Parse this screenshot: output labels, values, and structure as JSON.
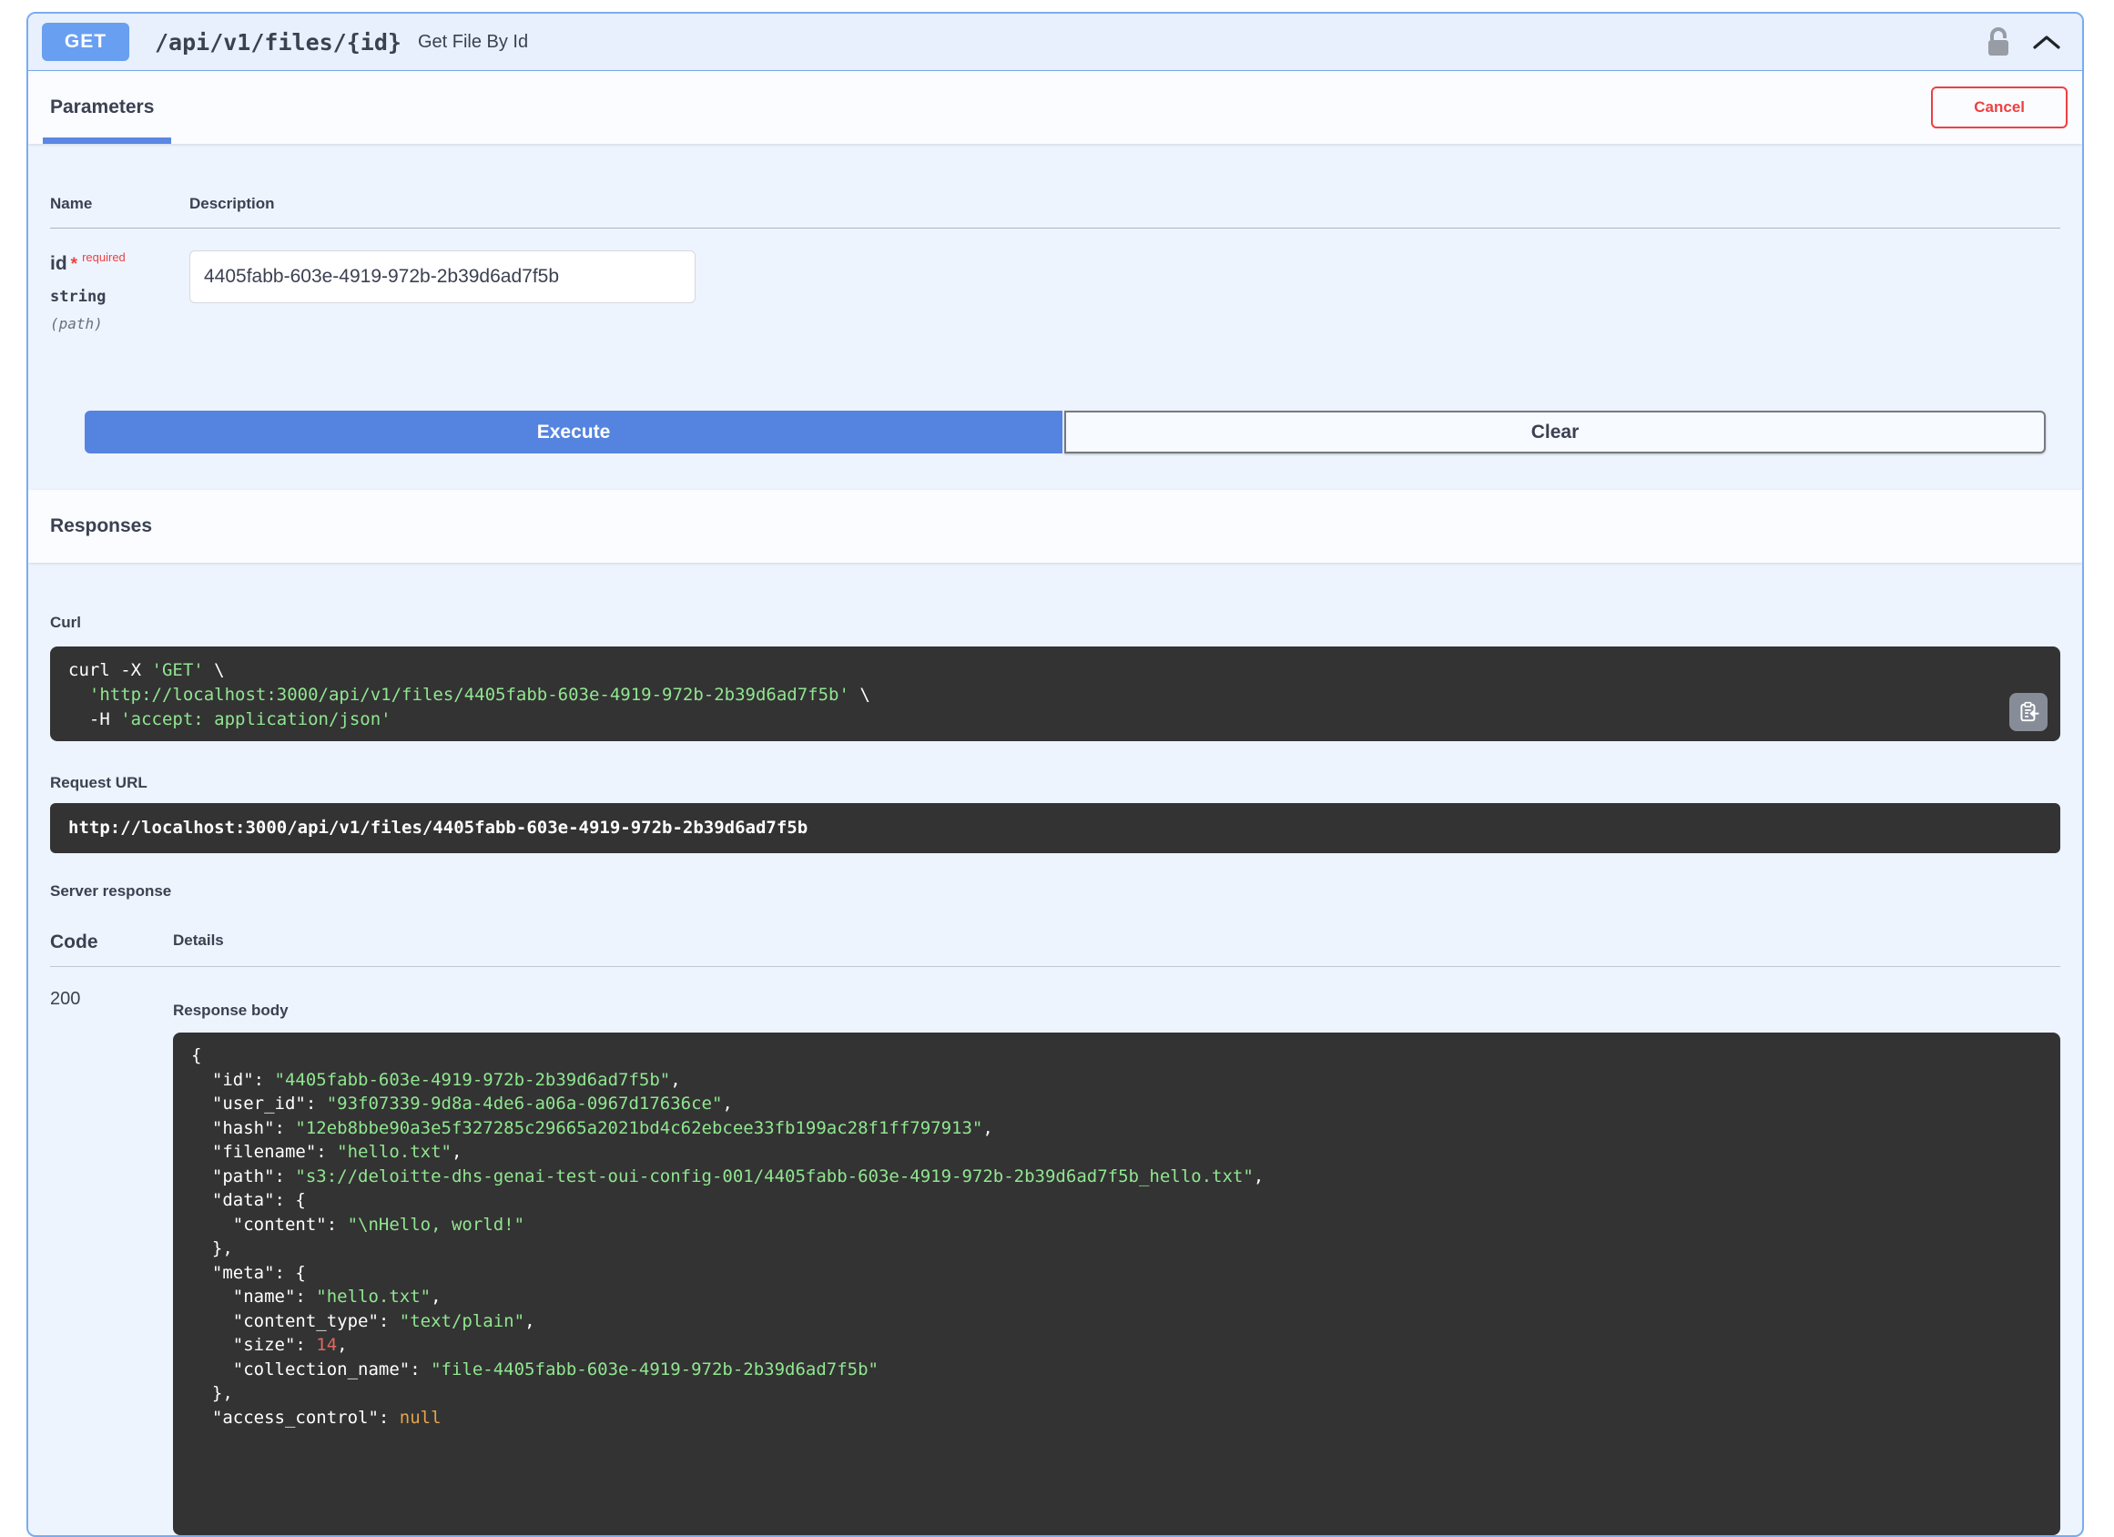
{
  "endpoint": {
    "method": "GET",
    "path": "/api/v1/files/{id}",
    "summary": "Get File By Id"
  },
  "parameters_section": {
    "title": "Parameters",
    "cancel_label": "Cancel",
    "columns": {
      "name": "Name",
      "description": "Description"
    },
    "param": {
      "name": "id",
      "required_star": "*",
      "required_label": "required",
      "type": "string",
      "location": "(path)",
      "value": "4405fabb-603e-4919-972b-2b39d6ad7f5b"
    }
  },
  "controls": {
    "execute_label": "Execute",
    "clear_label": "Clear"
  },
  "responses_section": {
    "title": "Responses",
    "curl": {
      "label": "Curl",
      "lines": [
        [
          {
            "text": "curl -X ",
            "type": "plain"
          },
          {
            "text": "'GET'",
            "type": "string"
          },
          {
            "text": " \\",
            "type": "plain"
          }
        ],
        [
          {
            "text": "  ",
            "type": "plain"
          },
          {
            "text": "'http://localhost:3000/api/v1/files/4405fabb-603e-4919-972b-2b39d6ad7f5b'",
            "type": "string"
          },
          {
            "text": " \\",
            "type": "plain"
          }
        ],
        [
          {
            "text": "  -H ",
            "type": "plain"
          },
          {
            "text": "'accept: application/json'",
            "type": "string"
          }
        ]
      ]
    },
    "request_url": {
      "label": "Request URL",
      "value": "http://localhost:3000/api/v1/files/4405fabb-603e-4919-972b-2b39d6ad7f5b"
    },
    "server_response": {
      "label": "Server response",
      "columns": {
        "code": "Code",
        "details": "Details"
      },
      "status_code": "200",
      "response_body_label": "Response body",
      "body_lines": [
        [
          {
            "text": "{",
            "type": "plain"
          }
        ],
        [
          {
            "text": "  \"id\": ",
            "type": "plain"
          },
          {
            "text": "\"4405fabb-603e-4919-972b-2b39d6ad7f5b\"",
            "type": "string"
          },
          {
            "text": ",",
            "type": "plain"
          }
        ],
        [
          {
            "text": "  \"user_id\": ",
            "type": "plain"
          },
          {
            "text": "\"93f07339-9d8a-4de6-a06a-0967d17636ce\"",
            "type": "string"
          },
          {
            "text": ",",
            "type": "plain"
          }
        ],
        [
          {
            "text": "  \"hash\": ",
            "type": "plain"
          },
          {
            "text": "\"12eb8bbe90a3e5f327285c29665a2021bd4c62ebcee33fb199ac28f1ff797913\"",
            "type": "string"
          },
          {
            "text": ",",
            "type": "plain"
          }
        ],
        [
          {
            "text": "  \"filename\": ",
            "type": "plain"
          },
          {
            "text": "\"hello.txt\"",
            "type": "string"
          },
          {
            "text": ",",
            "type": "plain"
          }
        ],
        [
          {
            "text": "  \"path\": ",
            "type": "plain"
          },
          {
            "text": "\"s3://deloitte-dhs-genai-test-oui-config-001/4405fabb-603e-4919-972b-2b39d6ad7f5b_hello.txt\"",
            "type": "string"
          },
          {
            "text": ",",
            "type": "plain"
          }
        ],
        [
          {
            "text": "  \"data\": {",
            "type": "plain"
          }
        ],
        [
          {
            "text": "    \"content\": ",
            "type": "plain"
          },
          {
            "text": "\"\\nHello, world!\"",
            "type": "string"
          }
        ],
        [
          {
            "text": "  },",
            "type": "plain"
          }
        ],
        [
          {
            "text": "  \"meta\": {",
            "type": "plain"
          }
        ],
        [
          {
            "text": "    \"name\": ",
            "type": "plain"
          },
          {
            "text": "\"hello.txt\"",
            "type": "string"
          },
          {
            "text": ",",
            "type": "plain"
          }
        ],
        [
          {
            "text": "    \"content_type\": ",
            "type": "plain"
          },
          {
            "text": "\"text/plain\"",
            "type": "string"
          },
          {
            "text": ",",
            "type": "plain"
          }
        ],
        [
          {
            "text": "    \"size\": ",
            "type": "plain"
          },
          {
            "text": "14",
            "type": "number"
          },
          {
            "text": ",",
            "type": "plain"
          }
        ],
        [
          {
            "text": "    \"collection_name\": ",
            "type": "plain"
          },
          {
            "text": "\"file-4405fabb-603e-4919-972b-2b39d6ad7f5b\"",
            "type": "string"
          }
        ],
        [
          {
            "text": "  },",
            "type": "plain"
          }
        ],
        [
          {
            "text": "  \"access_control\": ",
            "type": "plain"
          },
          {
            "text": "null",
            "type": "null"
          }
        ]
      ]
    }
  },
  "icons": {
    "auth": "unlock-icon",
    "collapse": "chevron-up-icon",
    "copy": "clipboard-copy-icon"
  },
  "colors": {
    "accent-blue": "#689ff1",
    "execute-blue": "#5584e0",
    "cancel-red": "#ef4040",
    "card-border": "#7aabf2",
    "card-bg": "#edf4fd",
    "header-bg": "#e7f0fc",
    "band-bg": "#fafcff",
    "tab-underline": "#5b87e2",
    "code-bg": "#333333",
    "code-plain": "#ffffff",
    "code-string": "#90e690",
    "code-number": "#e0695f",
    "code-null": "#e5a44a",
    "text-dark": "#3b4151"
  }
}
